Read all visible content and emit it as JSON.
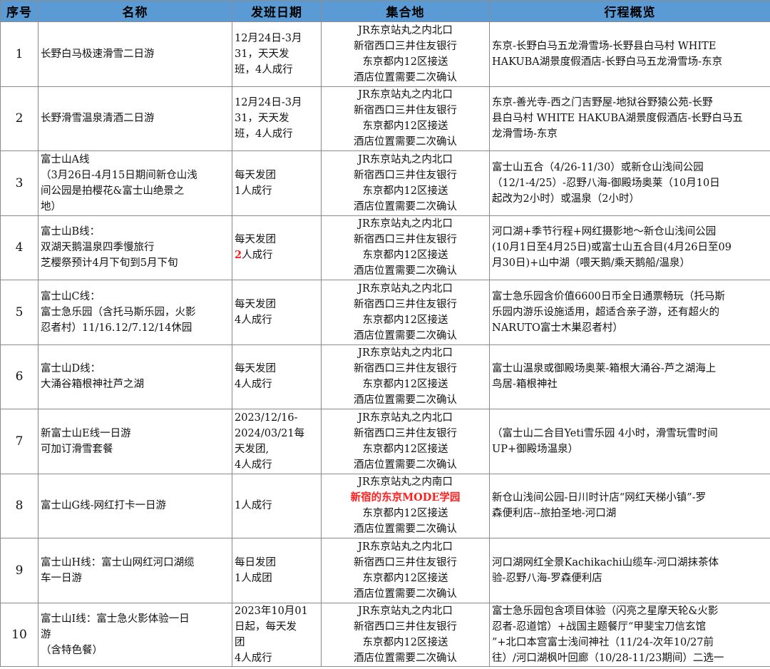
{
  "headers": {
    "no": "序号",
    "name": "名称",
    "date": "发班日期",
    "meet": "集合地",
    "summary": "行程概览"
  },
  "rows": [
    {
      "no": "1",
      "name": [
        "长野白马极速滑雪二日游"
      ],
      "date": [
        "12月24日-3月",
        "31，天天发",
        "班，4人成行"
      ],
      "meet": [
        "JR东京站丸之内北口",
        "新宿西口三井住友银行",
        "东京都内12区接送",
        "酒店位置需要二次确认"
      ],
      "summary": [
        "东京-长野白马五龙滑雪场-长野县白马村 WHITE",
        "HAKUBA湖景度假酒店-长野白马五龙滑雪场-东京"
      ]
    },
    {
      "no": "2",
      "name": [
        "长野滑雪温泉清酒二日游"
      ],
      "date": [
        "12月24日-3月",
        "31，天天发",
        "班，4人成行"
      ],
      "meet": [
        "JR东京站丸之内北口",
        "新宿西口三井住友银行",
        "东京都内12区接送",
        "酒店位置需要二次确认"
      ],
      "summary": [
        "东京-善光寺-西之门吉野屋-地狱谷野猿公苑-长野",
        "县白马村 WHITE HAKUBA湖景度假酒店-长野白马五",
        "龙滑雪场-东京"
      ]
    },
    {
      "no": "3",
      "name": [
        "富士山A线",
        "（3月26日-4月15日期间新仓山浅",
        "间公园是拍樱花&富士山绝景之",
        "地）"
      ],
      "date": [
        "每天发团",
        "1人成行"
      ],
      "meet": [
        "JR东京站丸之内北口",
        "新宿西口三井住友银行",
        "东京都内12区接送",
        "酒店位置需要二次确认"
      ],
      "summary": [
        "富士山五合（4/26-11/30）或新仓山浅间公园",
        "（12/1-4/25）-忍野八海-御殿场奥莱（10月10日",
        "起改为2小时）或温泉（2小时）"
      ]
    },
    {
      "no": "4",
      "name": [
        "富士山B线：",
        "双湖天鹅温泉四季慢旅行",
        "芝樱祭预计4月下旬到5月下旬"
      ],
      "date_line1": "每天发团",
      "date_red": "2",
      "date_rest": "人成行",
      "meet": [
        "JR东京站丸之内北口",
        "新宿西口三井住友银行",
        "东京都内12区接送",
        "酒店位置需要二次确认"
      ],
      "summary": [
        "河口湖+季节行程+网红摄影地～新仓山浅间公园",
        "(10月1日至4月25日)或富士山五合目(4月26日至09",
        "月30日)+山中湖（喂天鹅/乘天鹅船/温泉）"
      ]
    },
    {
      "no": "5",
      "name": [
        "富士山C线：",
        "富士急乐园（含托马斯乐园，火影",
        "忍者村）11/16.12/7.12/14休园"
      ],
      "date": [
        "每天发团",
        "4人成行"
      ],
      "meet": [
        "JR东京站丸之内北口",
        "新宿西口三井住友银行",
        "东京都内12区接送",
        "酒店位置需要二次确认"
      ],
      "summary": [
        "富士急乐园含价值6600日币全日通票畅玩（托马斯",
        "乐园内游乐设施适用，超适合亲子游，还有超火的",
        "NARUTO富士木巣忍者村）"
      ]
    },
    {
      "no": "6",
      "name": [
        "富士山D线：",
        "大涌谷箱根神社芦之湖"
      ],
      "date": [
        "每天发团",
        "4人成行"
      ],
      "meet": [
        "JR东京站丸之内北口",
        "新宿西口三井住友银行",
        "东京都内12区接送",
        "酒店位置需要二次确认"
      ],
      "summary": [
        "富士山温泉或御殿场奥莱-箱根大涌谷-芦之湖海上",
        "鸟居-箱根神社"
      ]
    },
    {
      "no": "7",
      "name": [
        "新富士山E线一日游",
        "可加订滑雪套餐"
      ],
      "date": [
        "2023/12/16-",
        "2024/03/21每",
        "天发团,",
        "4人成行"
      ],
      "meet": [
        "JR东京站丸之内北口",
        "新宿西口三井住友银行",
        "东京都内12区接送",
        "酒店位置需要二次确认"
      ],
      "summary": [
        "（富士山二合目Yeti雪乐园 4小时，滑雪玩雪时间",
        "UP+御殿场温泉）"
      ]
    },
    {
      "no": "8",
      "name": [
        "富士山G线-网红打卡一日游"
      ],
      "date": [
        "1人成行"
      ],
      "meet_line1": "JR东京站丸之内南口",
      "meet_red": "新宿的东京MODE学园",
      "meet_line3": "东京都内12区接送",
      "meet_line4": "酒店位置需要二次确认",
      "summary": [
        "新仓山浅间公园-日川时计店“网红天梯小镇”-罗",
        "森便利店--旅拍圣地-河口湖"
      ]
    },
    {
      "no": "9",
      "name": [
        "富士山H线：富士山网红河口湖缆",
        "车一日游"
      ],
      "date": [
        "每日发团",
        "1人成团"
      ],
      "meet": [
        "JR东京站丸之内北口",
        "新宿西口三井住友银行",
        "东京都内12区接送",
        "酒店位置需要二次确认"
      ],
      "summary": [
        "河口湖网红全景Kachikachi山缆车-河口湖抹茶体",
        "验-忍野八海-罗森便利店"
      ]
    },
    {
      "no": "10",
      "name": [
        "富士山I线：富士急火影体验一日",
        "游",
        "（含特色餐）"
      ],
      "date": [
        "2023年10月01",
        "日起，每天发",
        "团",
        "4人成行"
      ],
      "meet": [
        "JR东京站丸之内北口",
        "新宿西口三井住友银行",
        "东京都内12区接送",
        "酒店位置需要二次确认"
      ],
      "summary": [
        "富士急乐园包含项目体验（闪亮之星摩天轮&火影",
        "忍者-忍道馆）+战国主题餐厅“甲斐宝刀信玄馆",
        "”+北口本宫富士浅间神社（11/24-次年10/27前",
        "往）/河口湖枫叶回廊（10/28-11/23期间）二选一"
      ]
    }
  ],
  "colors": {
    "header_bg": "#5b9bd5",
    "highlight": "#ff1f1f",
    "border": "#8c8c8c"
  }
}
